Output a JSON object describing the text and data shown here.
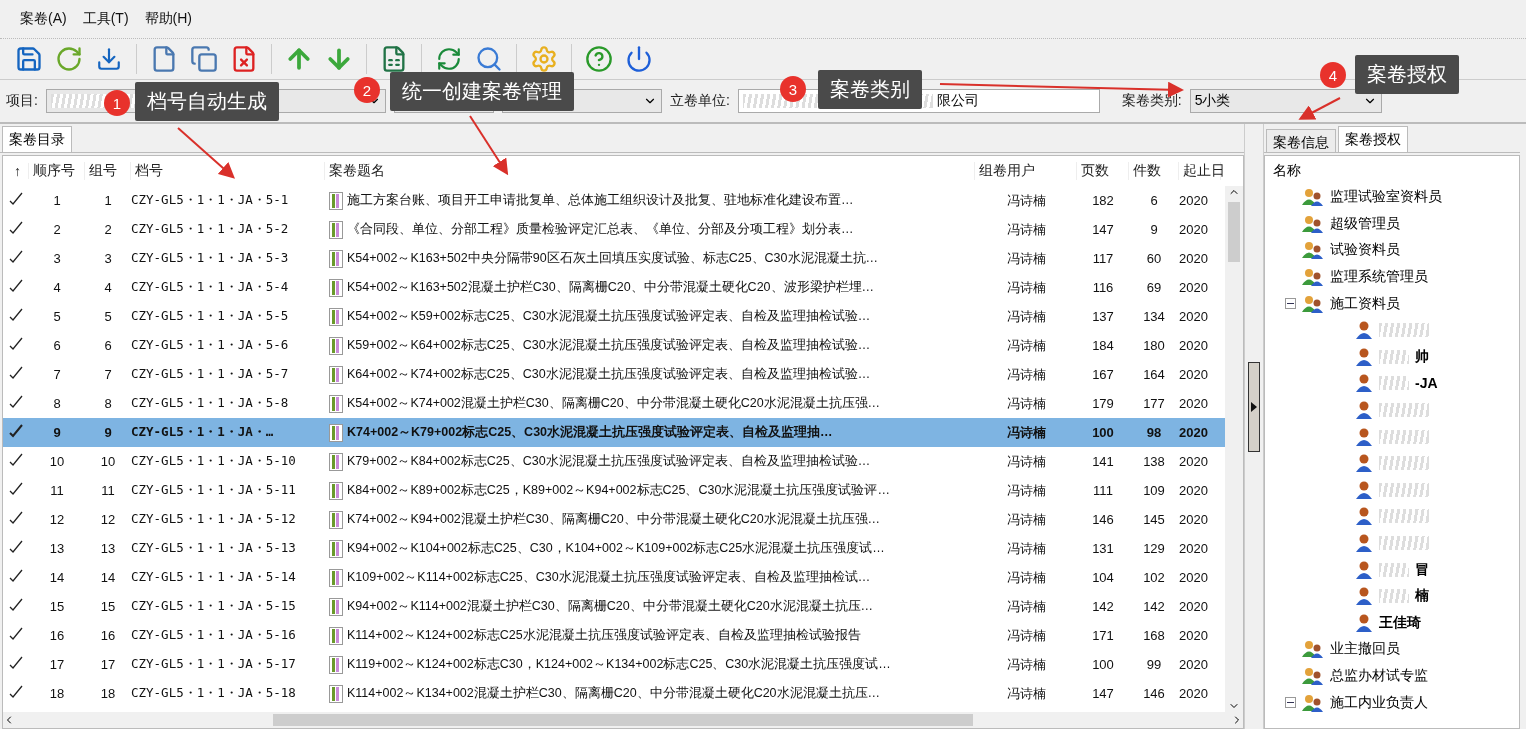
{
  "menu": [
    "案卷(A)",
    "工具(T)",
    "帮助(H)"
  ],
  "filters": {
    "project_label": "项目:",
    "unit_label": "立卷单位:",
    "unit_value": "限公司",
    "category_label": "案卷类别:",
    "category_value": "5小类"
  },
  "left_tabs": [
    {
      "label": "案卷目录",
      "selected": true
    }
  ],
  "table": {
    "columns": [
      "↑",
      "顺序号",
      "组号",
      "档号",
      "案卷题名",
      "组卷用户",
      "页数",
      "件数",
      "起止日"
    ],
    "rows": [
      {
        "checked": true,
        "selected": false,
        "seq": "1",
        "group": "1",
        "code": "CZY-GL5・1・1・JA・5-1",
        "title": "施工方案台账、项目开工申请批复单、总体施工组织设计及批复、驻地标准化建设布置…",
        "user": "冯诗楠",
        "pages": "182",
        "pieces": "6",
        "date": "2020"
      },
      {
        "checked": true,
        "selected": false,
        "seq": "2",
        "group": "2",
        "code": "CZY-GL5・1・1・JA・5-2",
        "title": "《合同段、单位、分部工程》质量检验评定汇总表、《单位、分部及分项工程》划分表…",
        "user": "冯诗楠",
        "pages": "147",
        "pieces": "9",
        "date": "2020"
      },
      {
        "checked": true,
        "selected": false,
        "seq": "3",
        "group": "3",
        "code": "CZY-GL5・1・1・JA・5-3",
        "title": "K54+002～K163+502中央分隔带90区石灰土回填压实度试验、标志C25、C30水泥混凝土抗…",
        "user": "冯诗楠",
        "pages": "117",
        "pieces": "60",
        "date": "2020"
      },
      {
        "checked": true,
        "selected": false,
        "seq": "4",
        "group": "4",
        "code": "CZY-GL5・1・1・JA・5-4",
        "title": "K54+002～K163+502混凝土护栏C30、隔离栅C20、中分带混凝土硬化C20、波形梁护栏埋…",
        "user": "冯诗楠",
        "pages": "116",
        "pieces": "69",
        "date": "2020"
      },
      {
        "checked": true,
        "selected": false,
        "seq": "5",
        "group": "5",
        "code": "CZY-GL5・1・1・JA・5-5",
        "title": "K54+002～K59+002标志C25、C30水泥混凝土抗压强度试验评定表、自检及监理抽检试验…",
        "user": "冯诗楠",
        "pages": "137",
        "pieces": "134",
        "date": "2020"
      },
      {
        "checked": true,
        "selected": false,
        "seq": "6",
        "group": "6",
        "code": "CZY-GL5・1・1・JA・5-6",
        "title": "K59+002～K64+002标志C25、C30水泥混凝土抗压强度试验评定表、自检及监理抽检试验…",
        "user": "冯诗楠",
        "pages": "184",
        "pieces": "180",
        "date": "2020"
      },
      {
        "checked": true,
        "selected": false,
        "seq": "7",
        "group": "7",
        "code": "CZY-GL5・1・1・JA・5-7",
        "title": "K64+002～K74+002标志C25、C30水泥混凝土抗压强度试验评定表、自检及监理抽检试验…",
        "user": "冯诗楠",
        "pages": "167",
        "pieces": "164",
        "date": "2020"
      },
      {
        "checked": true,
        "selected": false,
        "seq": "8",
        "group": "8",
        "code": "CZY-GL5・1・1・JA・5-8",
        "title": "K54+002～K74+002混凝土护栏C30、隔离栅C20、中分带混凝土硬化C20水泥混凝土抗压强…",
        "user": "冯诗楠",
        "pages": "179",
        "pieces": "177",
        "date": "2020"
      },
      {
        "checked": true,
        "selected": true,
        "seq": "9",
        "group": "9",
        "code": "CZY-GL5・1・1・JA・…",
        "title": "K74+002～K79+002标志C25、C30水泥混凝土抗压强度试验评定表、自检及监理抽…",
        "user": "冯诗楠",
        "pages": "100",
        "pieces": "98",
        "date": "2020"
      },
      {
        "checked": true,
        "selected": false,
        "seq": "10",
        "group": "10",
        "code": "CZY-GL5・1・1・JA・5-10",
        "title": "K79+002～K84+002标志C25、C30水泥混凝土抗压强度试验评定表、自检及监理抽检试验…",
        "user": "冯诗楠",
        "pages": "141",
        "pieces": "138",
        "date": "2020"
      },
      {
        "checked": true,
        "selected": false,
        "seq": "11",
        "group": "11",
        "code": "CZY-GL5・1・1・JA・5-11",
        "title": "K84+002～K89+002标志C25，K89+002～K94+002标志C25、C30水泥混凝土抗压强度试验评…",
        "user": "冯诗楠",
        "pages": "111",
        "pieces": "109",
        "date": "2020"
      },
      {
        "checked": true,
        "selected": false,
        "seq": "12",
        "group": "12",
        "code": "CZY-GL5・1・1・JA・5-12",
        "title": "K74+002～K94+002混凝土护栏C30、隔离栅C20、中分带混凝土硬化C20水泥混凝土抗压强…",
        "user": "冯诗楠",
        "pages": "146",
        "pieces": "145",
        "date": "2020"
      },
      {
        "checked": true,
        "selected": false,
        "seq": "13",
        "group": "13",
        "code": "CZY-GL5・1・1・JA・5-13",
        "title": "K94+002～K104+002标志C25、C30，K104+002～K109+002标志C25水泥混凝土抗压强度试…",
        "user": "冯诗楠",
        "pages": "131",
        "pieces": "129",
        "date": "2020"
      },
      {
        "checked": true,
        "selected": false,
        "seq": "14",
        "group": "14",
        "code": "CZY-GL5・1・1・JA・5-14",
        "title": "K109+002～K114+002标志C25、C30水泥混凝土抗压强度试验评定表、自检及监理抽检试…",
        "user": "冯诗楠",
        "pages": "104",
        "pieces": "102",
        "date": "2020"
      },
      {
        "checked": true,
        "selected": false,
        "seq": "15",
        "group": "15",
        "code": "CZY-GL5・1・1・JA・5-15",
        "title": "K94+002～K114+002混凝土护栏C30、隔离栅C20、中分带混凝土硬化C20水泥混凝土抗压…",
        "user": "冯诗楠",
        "pages": "142",
        "pieces": "142",
        "date": "2020"
      },
      {
        "checked": true,
        "selected": false,
        "seq": "16",
        "group": "16",
        "code": "CZY-GL5・1・1・JA・5-16",
        "title": "K114+002～K124+002标志C25水泥混凝土抗压强度试验评定表、自检及监理抽检试验报告",
        "user": "冯诗楠",
        "pages": "171",
        "pieces": "168",
        "date": "2020"
      },
      {
        "checked": true,
        "selected": false,
        "seq": "17",
        "group": "17",
        "code": "CZY-GL5・1・1・JA・5-17",
        "title": "K119+002～K124+002标志C30，K124+002～K134+002标志C25、C30水泥混凝土抗压强度试…",
        "user": "冯诗楠",
        "pages": "100",
        "pieces": "99",
        "date": "2020"
      },
      {
        "checked": true,
        "selected": false,
        "seq": "18",
        "group": "18",
        "code": "CZY-GL5・1・1・JA・5-18",
        "title": "K114+002～K134+002混凝土护栏C30、隔离栅C20、中分带混凝土硬化C20水泥混凝土抗压…",
        "user": "冯诗楠",
        "pages": "147",
        "pieces": "146",
        "date": "2020"
      }
    ]
  },
  "right_tabs": [
    {
      "label": "案卷信息",
      "selected": false
    },
    {
      "label": "案卷授权",
      "selected": true
    }
  ],
  "tree": {
    "header": "名称",
    "items": [
      {
        "name": "监理试验室资料员"
      },
      {
        "name": "超级管理员"
      },
      {
        "name": "试验资料员"
      },
      {
        "name": "监理系统管理员"
      },
      {
        "name": "施工资料员",
        "expanded": true,
        "children": [
          {
            "kind": "redacted"
          },
          {
            "kind": "redacted",
            "name": "帅"
          },
          {
            "kind": "redacted",
            "name": "-JA"
          },
          {
            "kind": "redacted"
          },
          {
            "kind": "redacted"
          },
          {
            "kind": "redacted"
          },
          {
            "kind": "redacted"
          },
          {
            "kind": "redacted"
          },
          {
            "kind": "redacted"
          },
          {
            "kind": "redacted",
            "name": "冒"
          },
          {
            "kind": "redacted",
            "name": "楠"
          },
          {
            "kind": "plain",
            "name": "王佳琦"
          }
        ]
      },
      {
        "name": "业主撤回员"
      },
      {
        "name": "总监办材试专监"
      },
      {
        "name": "施工内业负责人",
        "expanded": true
      }
    ]
  },
  "annotations": [
    {
      "number": "1",
      "label": "档号自动生成"
    },
    {
      "number": "2",
      "label": "统一创建案卷管理"
    },
    {
      "number": "3",
      "label": "案卷类别"
    },
    {
      "number": "4",
      "label": "案卷授权"
    }
  ]
}
